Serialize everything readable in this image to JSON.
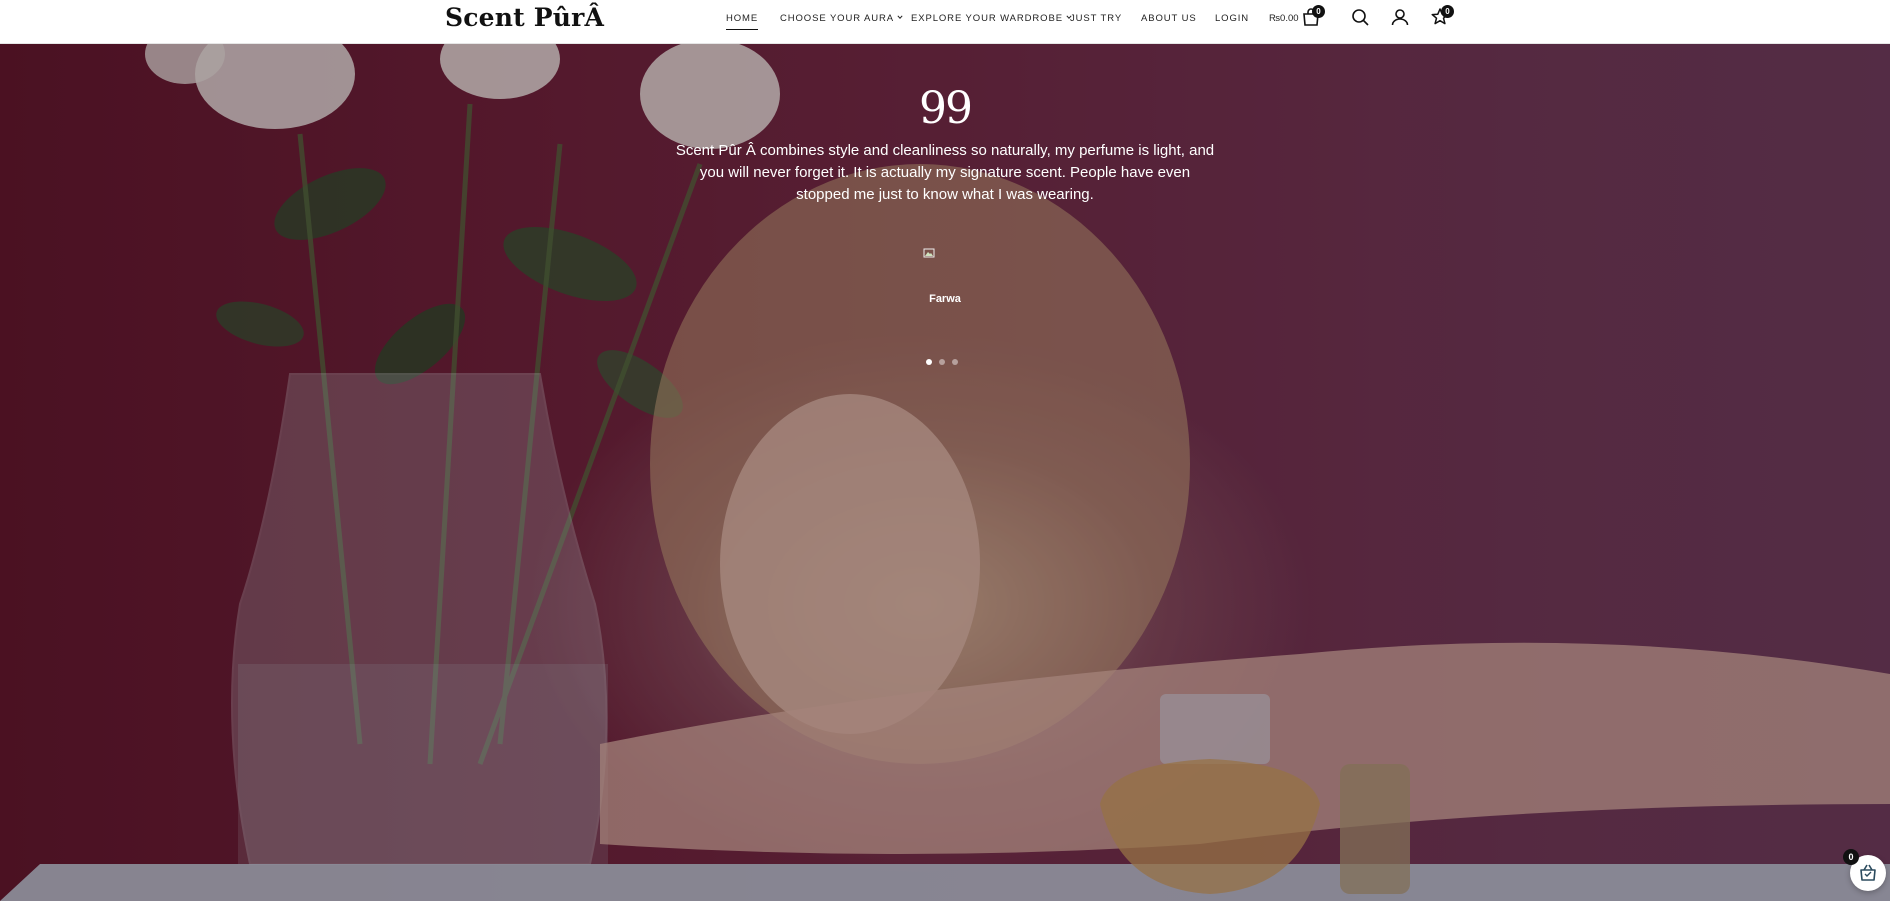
{
  "brand": {
    "logo_text": "Scent PûrÂ"
  },
  "nav": {
    "items": [
      {
        "label": "HOME",
        "active": true
      },
      {
        "label": "CHOOSE YOUR AURA",
        "dropdown": true
      },
      {
        "label": "EXPLORE YOUR WARDROBE",
        "dropdown": true
      },
      {
        "label": "JUST TRY"
      },
      {
        "label": "ABOUT US"
      },
      {
        "label": "LOGIN"
      }
    ],
    "cart_total": "₨0.00",
    "cart_count": "0",
    "wishlist_count": "0"
  },
  "testimonial": {
    "quote_mark": "99",
    "text": "Scent Pûr Â combines style and cleanliness so naturally, my perfume is light, and you will never forget it. It is actually my signature scent. People have even stopped me just to know what I was wearing.",
    "author": "Farwa",
    "slides_total": 3,
    "active_slide": 1
  },
  "floating_cart": {
    "count": "0"
  },
  "colors": {
    "accent": "#111111",
    "hero_bg": "#6a1f36"
  },
  "icons": [
    "chevron-down-icon",
    "shopping-bag-icon",
    "search-icon",
    "user-icon",
    "wishlist-star-icon",
    "basket-icon"
  ]
}
